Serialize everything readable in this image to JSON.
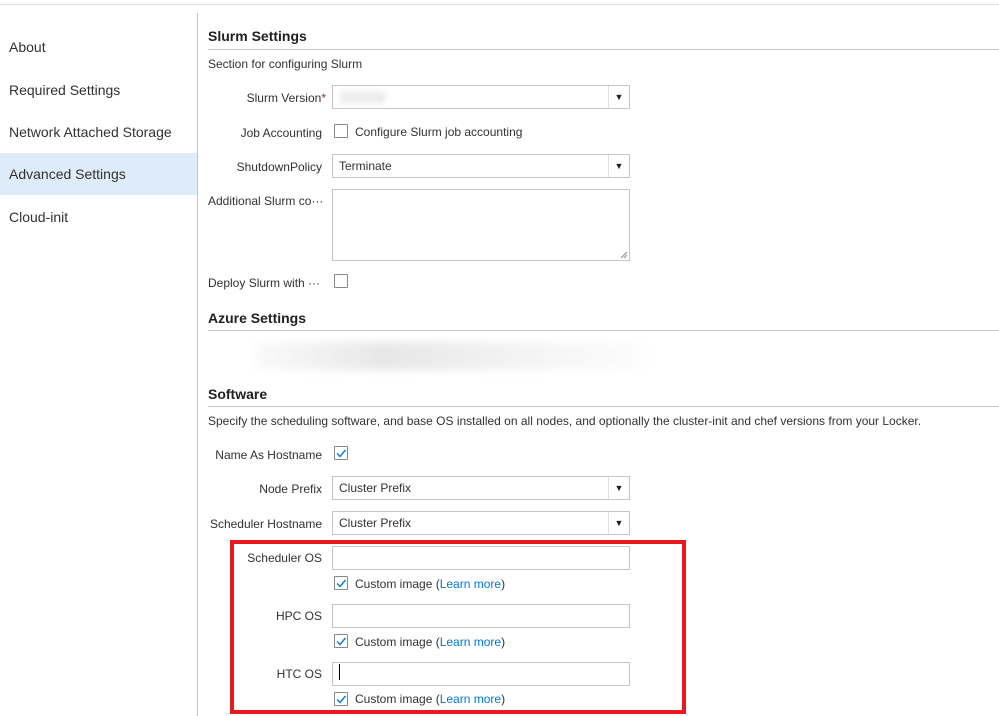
{
  "sidebar": {
    "items": [
      {
        "label": "About"
      },
      {
        "label": "Required Settings"
      },
      {
        "label": "Network Attached Storage"
      },
      {
        "label": "Advanced Settings"
      },
      {
        "label": "Cloud-init"
      }
    ],
    "active": "Advanced Settings"
  },
  "slurm": {
    "title": "Slurm Settings",
    "description": "Section for configuring Slurm",
    "version_label": "Slurm Version",
    "version_required": "*",
    "version_value": "",
    "job_accounting_label": "Job Accounting",
    "job_accounting_checkbox_label": "Configure Slurm job accounting",
    "job_accounting_checked": false,
    "shutdown_label": "ShutdownPolicy",
    "shutdown_value": "Terminate",
    "additional_label": "Additional Slurm co···",
    "additional_value": "",
    "deploy_label": "Deploy Slurm with ···",
    "deploy_checked": false
  },
  "azure": {
    "title": "Azure Settings"
  },
  "software": {
    "title": "Software",
    "description": "Specify the scheduling software, and base OS installed on all nodes, and optionally the cluster-init and chef versions from your Locker.",
    "name_as_hostname_label": "Name As Hostname",
    "name_as_hostname_checked": true,
    "node_prefix_label": "Node Prefix",
    "node_prefix_value": "Cluster Prefix",
    "scheduler_hostname_label": "Scheduler Hostname",
    "scheduler_hostname_value": "Cluster Prefix",
    "scheduler_os_label": "Scheduler OS",
    "scheduler_os_value": "",
    "hpc_os_label": "HPC OS",
    "hpc_os_value": "",
    "htc_os_label": "HTC OS",
    "htc_os_value": "",
    "custom_image_label": "Custom image (",
    "learn_more": "Learn more",
    "close_paren": ")",
    "custom_image_checked": [
      true,
      true,
      true
    ]
  },
  "colors": {
    "accent": "#0078d4",
    "active_nav": "#deecf9",
    "highlight_box": "#e8191c",
    "required": "#a4262c"
  },
  "icons": {
    "dropdown": "chevron-down-icon",
    "check": "checkmark-icon"
  }
}
